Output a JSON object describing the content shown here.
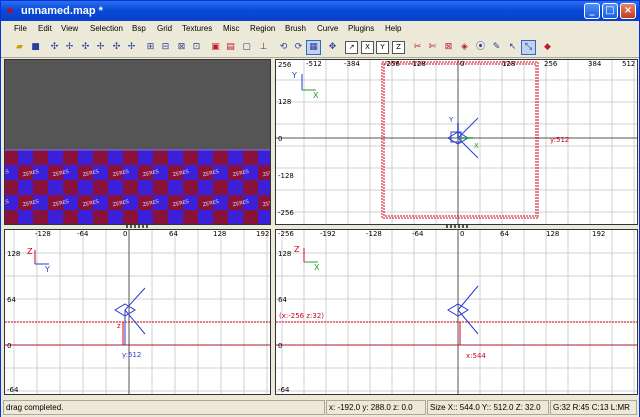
{
  "window": {
    "title": "unnamed.map *"
  },
  "menu": [
    "File",
    "Edit",
    "View",
    "Selection",
    "Bsp",
    "Grid",
    "Textures",
    "Misc",
    "Region",
    "Brush",
    "Curve",
    "Plugins",
    "Help"
  ],
  "toolbar": {
    "x_label": "X",
    "y_label": "Y",
    "z_label": "Z"
  },
  "xy_view": {
    "x_ticks": [
      "-512",
      "-384",
      "-256",
      "-128",
      "0",
      "128",
      "256",
      "384",
      "512"
    ],
    "y_ticks": [
      "256",
      "128",
      "0",
      "-128",
      "-256"
    ],
    "axis_h": "X",
    "axis_v": "Y",
    "y_size": "y:512",
    "origin_axis_y": "Y",
    "origin_axis_x": "X"
  },
  "yz_view": {
    "x_ticks": [
      "-128",
      "-64",
      "0",
      "64",
      "128",
      "192"
    ],
    "y_ticks": [
      "128",
      "64",
      "0",
      "-64"
    ],
    "axis_h": "Y",
    "axis_v": "Z",
    "z_size": "z",
    "y_size": "y:512"
  },
  "xz_view": {
    "x_ticks": [
      "-256",
      "-192",
      "-128",
      "-64",
      "0",
      "64",
      "128",
      "192"
    ],
    "y_ticks": [
      "128",
      "64",
      "0",
      "-64"
    ],
    "axis_h": "X",
    "axis_v": "Z",
    "coords": "(x:-256  z:32)",
    "x_size": "x:544"
  },
  "status": {
    "message": "drag completed.",
    "position": "x: -192.0  y: 288.0  z: 0.0",
    "size": "Size X:: 544.0  Y:: 512.0  Z: 32.0",
    "grid": "G:32 R:45 C:13 L:MR"
  },
  "colors": {
    "title_bar": "#0a4ad8",
    "grid": "#c8c8c8",
    "selection": "#d0021b",
    "camera_floor_a": "#3a1fd8",
    "camera_floor_b": "#8a1030"
  }
}
